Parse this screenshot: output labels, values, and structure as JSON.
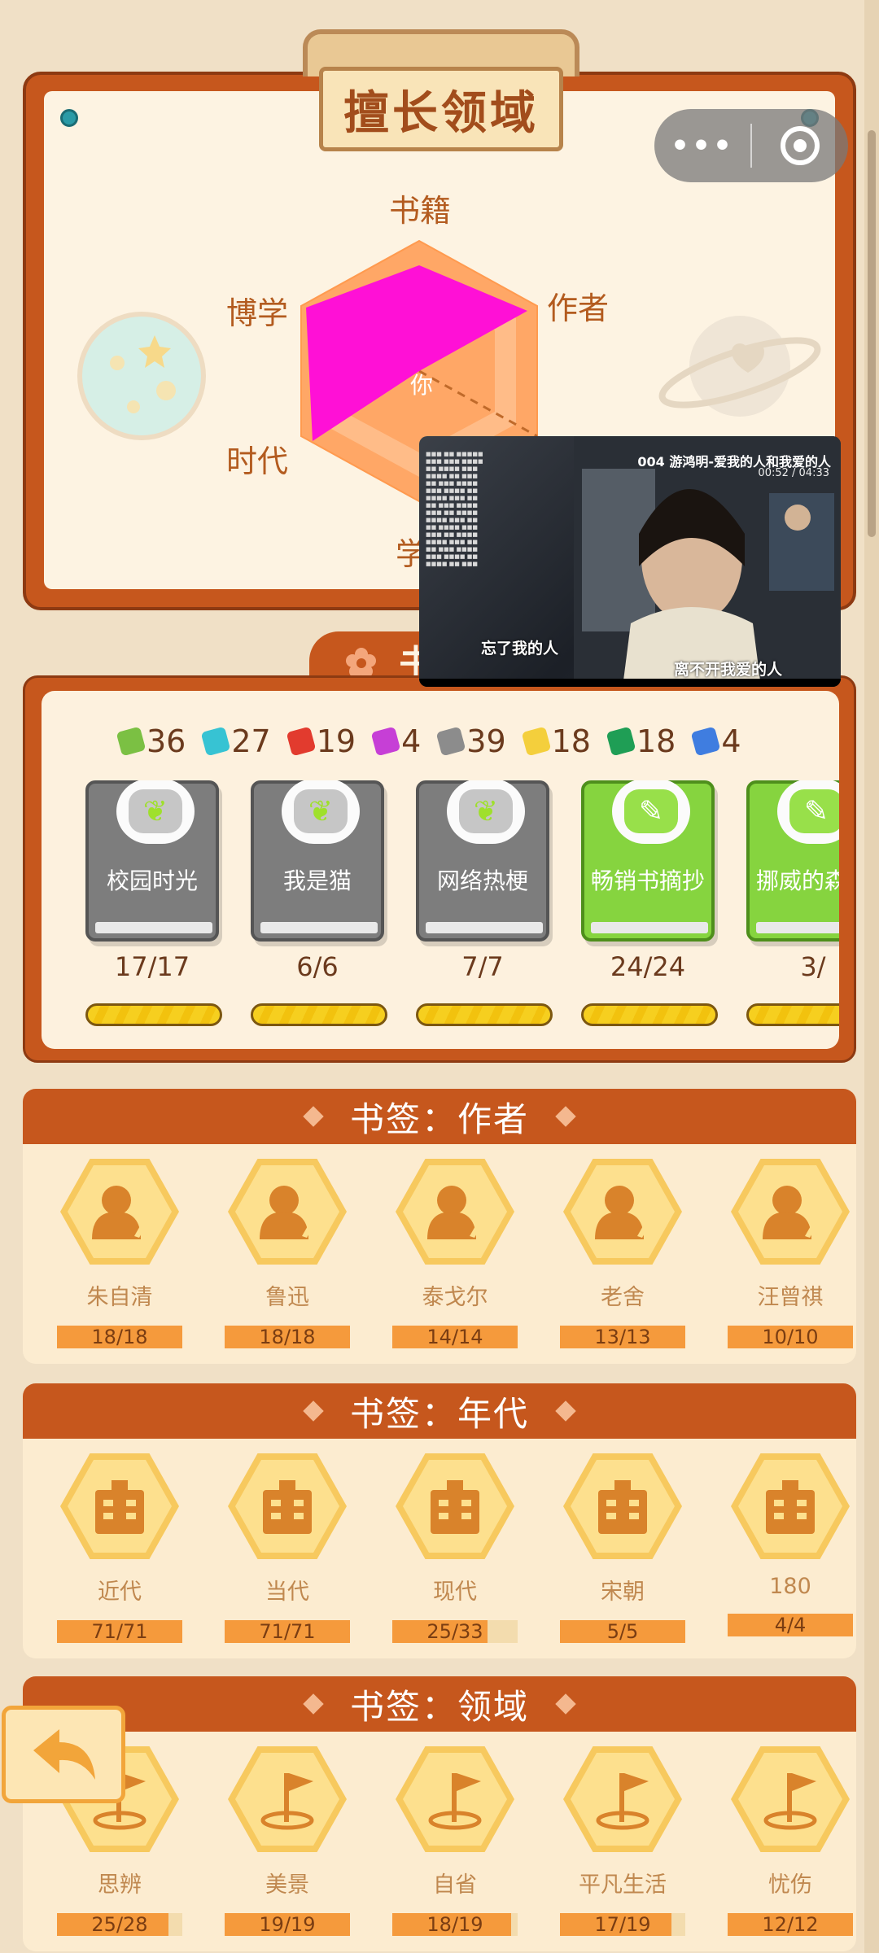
{
  "colors": {
    "accent": "#c6571d",
    "paper": "#fdf3e2",
    "polygon": "#ff10d6"
  },
  "radar": {
    "title": "擅长领域",
    "axes": [
      "书籍",
      "作者",
      "学",
      "时代",
      "博学"
    ],
    "center_label": "你"
  },
  "video_overlay": {
    "song_title": "004 游鸿明-爱我的人和我爱的人",
    "timecode": "00:52 / 04:33",
    "lyric_left": "忘了我的人",
    "lyric_right": "离不开我爱的人"
  },
  "collection": {
    "tab_label": "书",
    "pieces": [
      {
        "color": "#7bc043",
        "count": "36"
      },
      {
        "color": "#37c3d3",
        "count": "27"
      },
      {
        "color": "#e23b2e",
        "count": "19"
      },
      {
        "color": "#c63fd6",
        "count": "4"
      },
      {
        "color": "#8c8c8c",
        "count": "39"
      },
      {
        "color": "#f4cf3c",
        "count": "18"
      },
      {
        "color": "#1f9e55",
        "count": "18"
      },
      {
        "color": "#3f7de0",
        "count": "4"
      }
    ],
    "books": [
      {
        "name": "校园时光",
        "count": "17/17",
        "style": "gray",
        "icon": "sprout-icon"
      },
      {
        "name": "我是猫",
        "count": "6/6",
        "style": "gray",
        "icon": "sprout-icon"
      },
      {
        "name": "网络热梗",
        "count": "7/7",
        "style": "gray",
        "icon": "sprout-icon"
      },
      {
        "name": "畅销书摘抄",
        "count": "24/24",
        "style": "green",
        "icon": "pencil-ruler-icon"
      },
      {
        "name": "挪威的森林",
        "count": "3/",
        "style": "green",
        "icon": "pencil-ruler-icon"
      }
    ]
  },
  "sections": [
    {
      "title": "书签：作者",
      "icon": "author-icon",
      "items": [
        {
          "name": "朱自清",
          "progress": "18/18",
          "fraction": 1.0
        },
        {
          "name": "鲁迅",
          "progress": "18/18",
          "fraction": 1.0
        },
        {
          "name": "泰戈尔",
          "progress": "14/14",
          "fraction": 1.0
        },
        {
          "name": "老舍",
          "progress": "13/13",
          "fraction": 1.0
        },
        {
          "name": "汪曾祺",
          "progress": "10/10",
          "fraction": 1.0
        }
      ]
    },
    {
      "title": "书签：年代",
      "icon": "building-icon",
      "items": [
        {
          "name": "近代",
          "progress": "71/71",
          "fraction": 1.0
        },
        {
          "name": "当代",
          "progress": "71/71",
          "fraction": 1.0
        },
        {
          "name": "现代",
          "progress": "25/33",
          "fraction": 0.76
        },
        {
          "name": "宋朝",
          "progress": "5/5",
          "fraction": 1.0
        },
        {
          "name": "180",
          "progress": "4/4",
          "fraction": 1.0
        }
      ]
    },
    {
      "title": "书签：领域",
      "icon": "flag-icon",
      "items": [
        {
          "name": "思辨",
          "progress": "25/28",
          "fraction": 0.89
        },
        {
          "name": "美景",
          "progress": "19/19",
          "fraction": 1.0
        },
        {
          "name": "自省",
          "progress": "18/19",
          "fraction": 0.95
        },
        {
          "name": "平凡生活",
          "progress": "17/19",
          "fraction": 0.89
        },
        {
          "name": "忧伤",
          "progress": "12/12",
          "fraction": 1.0
        }
      ]
    }
  ]
}
